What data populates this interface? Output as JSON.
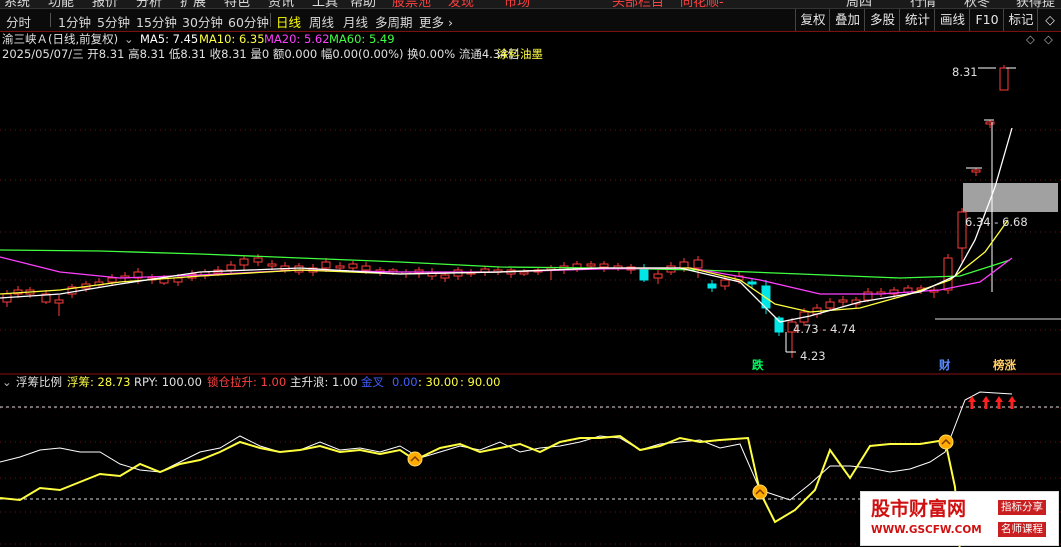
{
  "top_menu": [
    "系统",
    "功能",
    "报价",
    "分析",
    "扩展",
    "特色",
    "资讯",
    "工具",
    "帮助",
    "股票池",
    "发现",
    "市场",
    "头部栏目",
    "同花顺-",
    "周四",
    "行情",
    "秋冬",
    "获得提"
  ],
  "toolbar": {
    "left": [
      "分时",
      "1分钟",
      "5分钟",
      "15分钟",
      "30分钟",
      "60分钟",
      "日线",
      "周线",
      "月线",
      "多周期",
      "更多 ›"
    ],
    "active": "日线",
    "right": [
      "复权",
      "叠加",
      "多股",
      "统计",
      "画线",
      "F10",
      "标记",
      "◇"
    ]
  },
  "main_header": {
    "stock": "渝三峡Ａ(日线,前复权)",
    "ma5": "MA5: 7.45",
    "ma10": "MA10: 6.35",
    "ma20": "MA20: 5.62",
    "ma60": "MA60: 5.49",
    "info_line": "2025/05/07/三 开8.31 高8.31 低8.31 收8.31 量0 额0.000 幅0.00(0.00%) 换0.00% 流通4.34亿",
    "sector": "涂料油墨"
  },
  "price_annotations": {
    "high": "8.31",
    "zone": "6.34 - 6.68",
    "gap": "4.73 - 4.74",
    "low": "4.23"
  },
  "event_tags": {
    "fall": "跌",
    "finance": "财",
    "rank": "榜涨"
  },
  "indicator_header": {
    "name": "浮筹比例",
    "fc": "浮筹: 28.73",
    "rpy": "RPY: 100.00",
    "sclc": "锁仓拉升: 1.00",
    "zsl": "主升浪: 1.00",
    "jc": "金叉",
    "jc_val": "0.00",
    "v30": ": 30.00",
    "v90": ": 90.00"
  },
  "watermark": {
    "title": "股市财富网",
    "url": "WWW.GSCFW.COM",
    "tag1": "指标分享",
    "tag2": "名师课程"
  },
  "colors": {
    "up": "#ff3c3c",
    "down": "#00e5e5",
    "ma5": "#ffffff",
    "ma10": "#ffff40",
    "ma20": "#ff40ff",
    "ma60": "#40ff40",
    "accent": "#ffff00"
  }
}
